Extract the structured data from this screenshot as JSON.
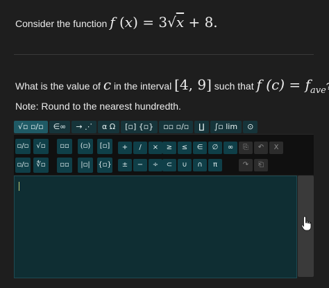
{
  "question": {
    "line1_text": "Consider the function",
    "line1_math": {
      "f": "f",
      "open": " (",
      "x": "x",
      "close": ")",
      "eq": " = 3",
      "sqrt": "√",
      "sqrt_arg": "x",
      "tail": " + 8."
    },
    "line2_text_a": "What is the value of",
    "line2_var": "c",
    "line2_text_b": "in the interval",
    "line2_interval": "[4, 9]",
    "line2_text_c": "such that",
    "line2_eq_lhs": "f (c)",
    "line2_eq": " = ",
    "line2_rhs": "f",
    "line2_rhs_sub": "ave",
    "line2_end": "?",
    "note": "Note: Round to the nearest hundredth."
  },
  "tabs": [
    {
      "label": "√▫ ▫/▫"
    },
    {
      "label": "∈∞"
    },
    {
      "label": "→ ⋰"
    },
    {
      "label": "α Ω"
    },
    {
      "label": "[▫] {▫}"
    },
    {
      "label": "▫▫ ▫/▫"
    },
    {
      "label": "∐"
    },
    {
      "label": "∫▫ lim"
    },
    {
      "label": "⊙"
    }
  ],
  "palette": {
    "row1": [
      "▫/▫",
      "√▫",
      "▫▫",
      "(▫)",
      "[▫]"
    ],
    "row2": [
      "▫/▫",
      "∜▫",
      "▫▫",
      "|▫|",
      "{▫}"
    ],
    "ops_row1": [
      "+",
      "/",
      "×",
      "≥",
      "≤",
      "∈",
      "∅",
      "∞"
    ],
    "ops_row2": [
      "±",
      "−",
      "÷",
      "⊂",
      "∪",
      "∩",
      "π"
    ],
    "edit_row1": [
      "⎘",
      "↶",
      "X"
    ],
    "edit_row2": [
      "↷",
      "⎗"
    ]
  },
  "editor": {
    "value": ""
  },
  "icons": {
    "scroll": "hand-cursor-icon"
  }
}
